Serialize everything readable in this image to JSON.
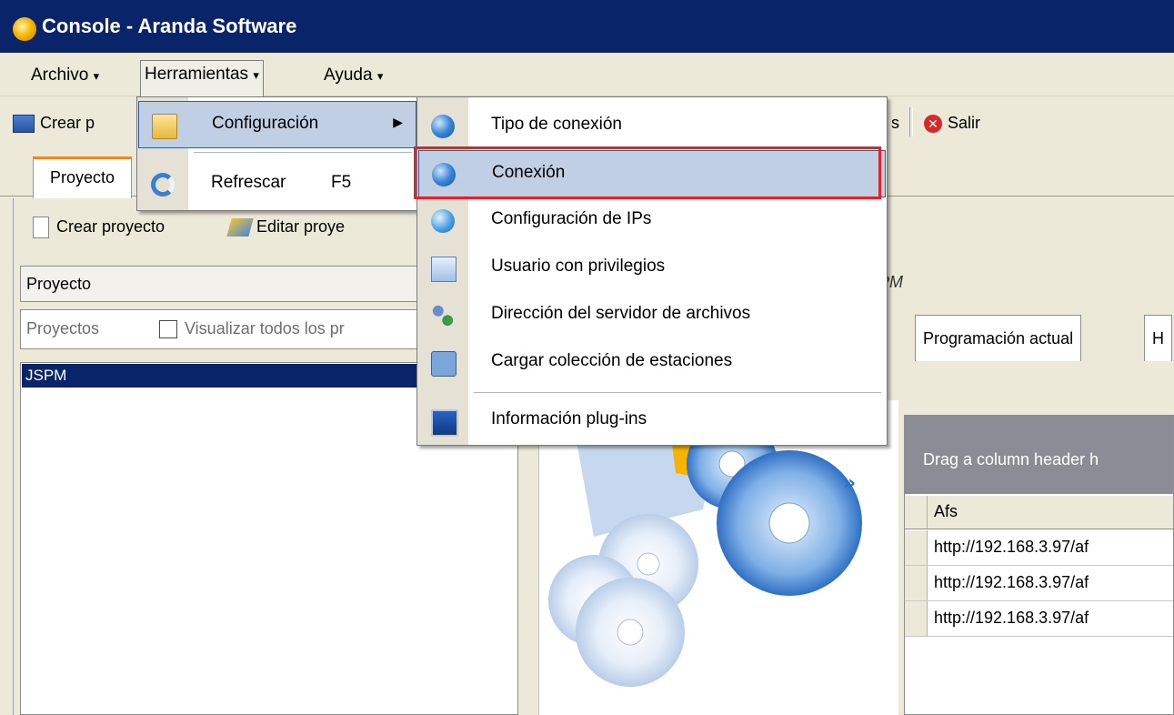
{
  "window": {
    "title": "Console - Aranda Software",
    "icon": "aranda-app-icon"
  },
  "menubar": {
    "items": [
      {
        "label": "Archivo",
        "arrow": "▾"
      },
      {
        "label": "Herramientas",
        "arrow": "▾"
      },
      {
        "label": "Ayuda",
        "arrow": "▾"
      }
    ]
  },
  "toolbar": {
    "create_partial": "Crear p",
    "fragment": "s",
    "salir": "Salir"
  },
  "tabs": {
    "proyectos_partial": "Proyecto"
  },
  "left_panel": {
    "create_project": "Crear proyecto",
    "edit_project_partial": "Editar proye",
    "header": "Proyecto",
    "filter_label": "Proyectos",
    "checkbox_label_partial": "Visualizar todos los pr",
    "selected_row": "JSPM"
  },
  "right_panel": {
    "header_fragment": "PM",
    "tab_programacion": "Programación actual",
    "tab_fragment": "H",
    "group_hint_partial": "Drag a column header h",
    "column_afs": "Afs",
    "rows": [
      "http://192.168.3.97/af",
      "http://192.168.3.97/af",
      "http://192.168.3.97/af"
    ]
  },
  "herramientas_menu": {
    "items": [
      {
        "label": "Configuración",
        "icon": "folder-gear-icon",
        "submenu_arrow": "▶"
      },
      {
        "label": "Refrescar",
        "shortcut": "F5",
        "icon": "refresh-icon"
      }
    ]
  },
  "configuracion_submenu": {
    "items": [
      {
        "label": "Tipo de conexión",
        "icon": "globe-icon"
      },
      {
        "label": "Conexión",
        "icon": "globe-icon"
      },
      {
        "label": "Configuración de IPs",
        "icon": "network-globe-icon"
      },
      {
        "label": "Usuario con privilegios",
        "icon": "user-card-icon"
      },
      {
        "label": "Dirección del servidor de archivos",
        "icon": "server-users-icon"
      },
      {
        "label": "Cargar colección de estaciones",
        "icon": "reload-stations-icon"
      },
      {
        "label": "Información plug-ins",
        "icon": "monitor-plugin-icon"
      }
    ]
  },
  "colors": {
    "titlebar": "#0a246a",
    "selection": "#0a246a",
    "menu_highlight": "#c1cfe4",
    "highlight_border_red": "#e0232c"
  }
}
